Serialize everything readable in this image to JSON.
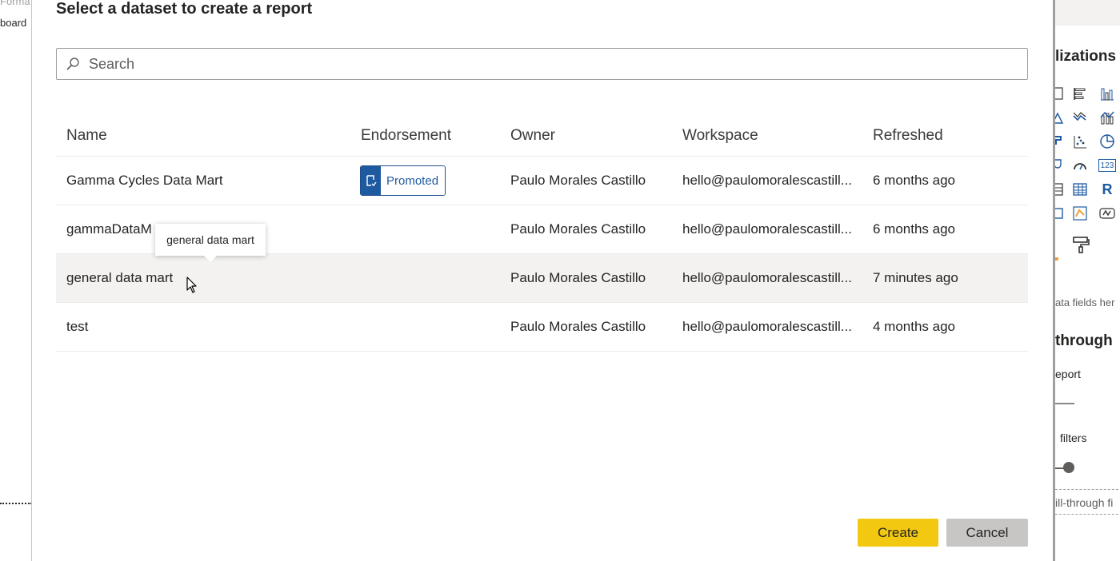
{
  "background_left": {
    "top_text": "Forma",
    "board_text": "board"
  },
  "background_right": {
    "pane_title": "lizations",
    "fields_hint": "ata fields her",
    "section_title": "through",
    "report_label": "eport",
    "filters_label": "filters",
    "drill_label": "ill-through fi",
    "numeric_icon_text": "123",
    "r_icon_text": "R"
  },
  "dialog": {
    "title": "Select a dataset to create a report",
    "search": {
      "placeholder": "Search"
    },
    "columns": {
      "name": "Name",
      "endorsement": "Endorsement",
      "owner": "Owner",
      "workspace": "Workspace",
      "refreshed": "Refreshed"
    },
    "rows": [
      {
        "name": "Gamma Cycles Data Mart",
        "endorsement": "Promoted",
        "owner": "Paulo Morales Castillo",
        "workspace": "hello@paulomoralescastill...",
        "refreshed": "6 months ago"
      },
      {
        "name": "gammaDataM",
        "endorsement": "",
        "owner": "Paulo Morales Castillo",
        "workspace": "hello@paulomoralescastill...",
        "refreshed": "6 months ago"
      },
      {
        "name": "general data mart",
        "endorsement": "",
        "owner": "Paulo Morales Castillo",
        "workspace": "hello@paulomoralescastill...",
        "refreshed": "7 minutes ago"
      },
      {
        "name": "test",
        "endorsement": "",
        "owner": "Paulo Morales Castillo",
        "workspace": "hello@paulomoralescastill...",
        "refreshed": "4 months ago"
      }
    ],
    "tooltip": "general data mart",
    "buttons": {
      "create": "Create",
      "cancel": "Cancel"
    }
  },
  "colors": {
    "accent_yellow": "#f2c811",
    "promoted_blue": "#1e5aa0",
    "hover_row": "#f3f2f1",
    "cancel_gray": "#c8c6c4"
  }
}
